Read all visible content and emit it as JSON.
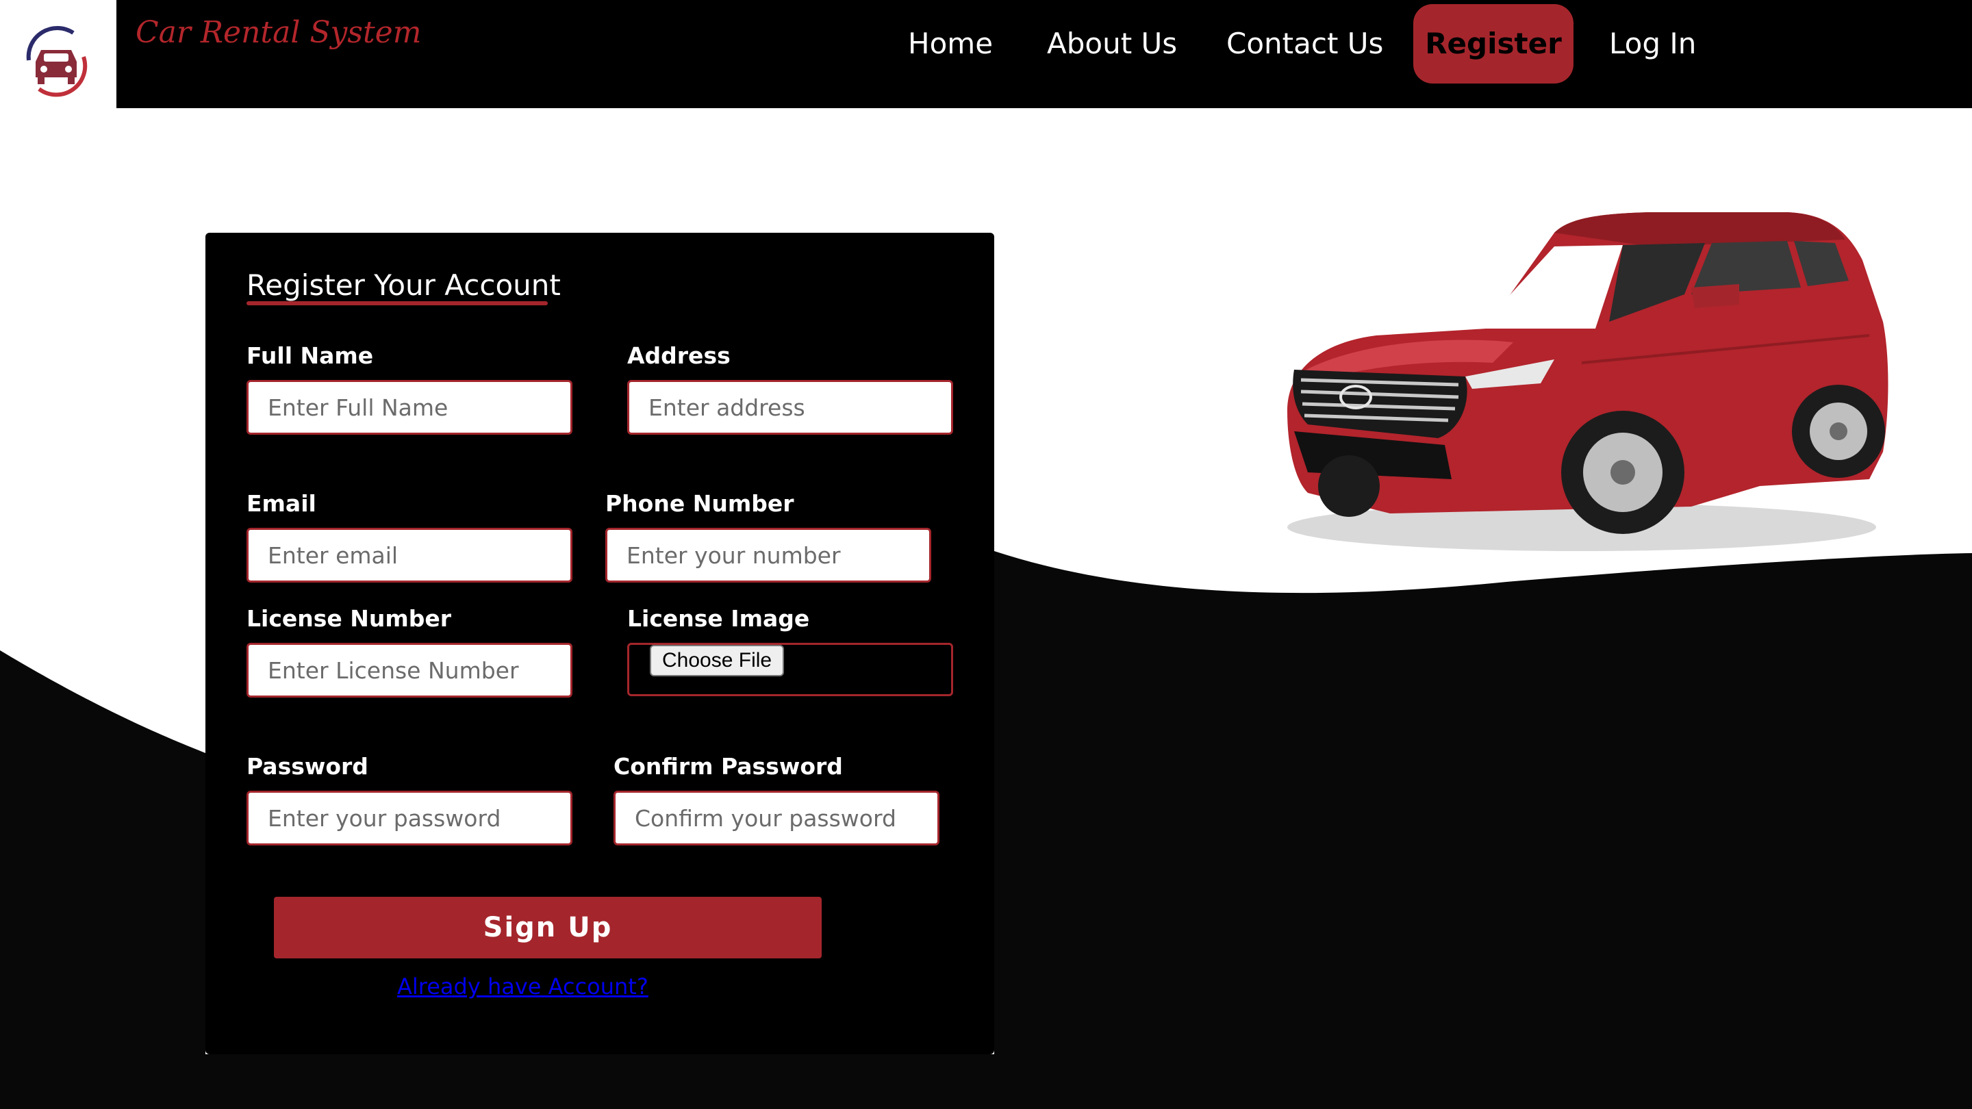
{
  "brand": {
    "name": "Car Rental System"
  },
  "nav": {
    "home": "Home",
    "about": "About Us",
    "contact": "Contact Us",
    "register": "Register",
    "login": "Log In"
  },
  "form": {
    "title": "Register Your Account",
    "full_name": {
      "label": "Full Name",
      "placeholder": "Enter Full Name"
    },
    "address": {
      "label": "Address",
      "placeholder": "Enter address"
    },
    "email": {
      "label": "Email",
      "placeholder": "Enter email"
    },
    "phone": {
      "label": "Phone Number",
      "placeholder": "Enter your number"
    },
    "license_number": {
      "label": "License Number",
      "placeholder": "Enter License Number"
    },
    "license_image": {
      "label": "License Image",
      "button": "Choose File"
    },
    "password": {
      "label": "Password",
      "placeholder": "Enter your password"
    },
    "confirm_password": {
      "label": "Confirm Password",
      "placeholder": "Confirm your password"
    },
    "submit": "Sign Up",
    "login_link": "Already have Account?"
  },
  "colors": {
    "accent": "#a4262c",
    "background_dark": "#000000",
    "background_light": "#ffffff",
    "link": "#0000ee"
  },
  "icons": [
    "car-logo-icon"
  ]
}
